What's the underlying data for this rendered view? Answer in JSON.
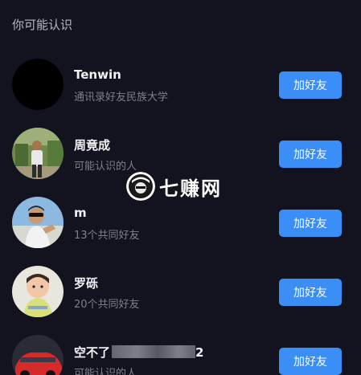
{
  "section": {
    "title": "你可能认识"
  },
  "suggestions": [
    {
      "name": "Tenwin",
      "sub": "通讯录好友民族大学",
      "action": "加好友"
    },
    {
      "name": "周竟成",
      "sub": "可能认识的人",
      "action": "加好友"
    },
    {
      "name": "m",
      "sub": "13个共同好友",
      "action": "加好友"
    },
    {
      "name": "罗砾",
      "sub": "20个共同好友",
      "action": "加好友"
    },
    {
      "name": "空不了",
      "name_tail": "2",
      "sub": "可能认识的人",
      "action": "加好友"
    }
  ],
  "watermark": {
    "text": "七赚网"
  },
  "colors": {
    "background": "#13131f",
    "button": "#3a8ef6",
    "name_text": "#f2f2f5",
    "sub_text": "#7f7f8a"
  }
}
